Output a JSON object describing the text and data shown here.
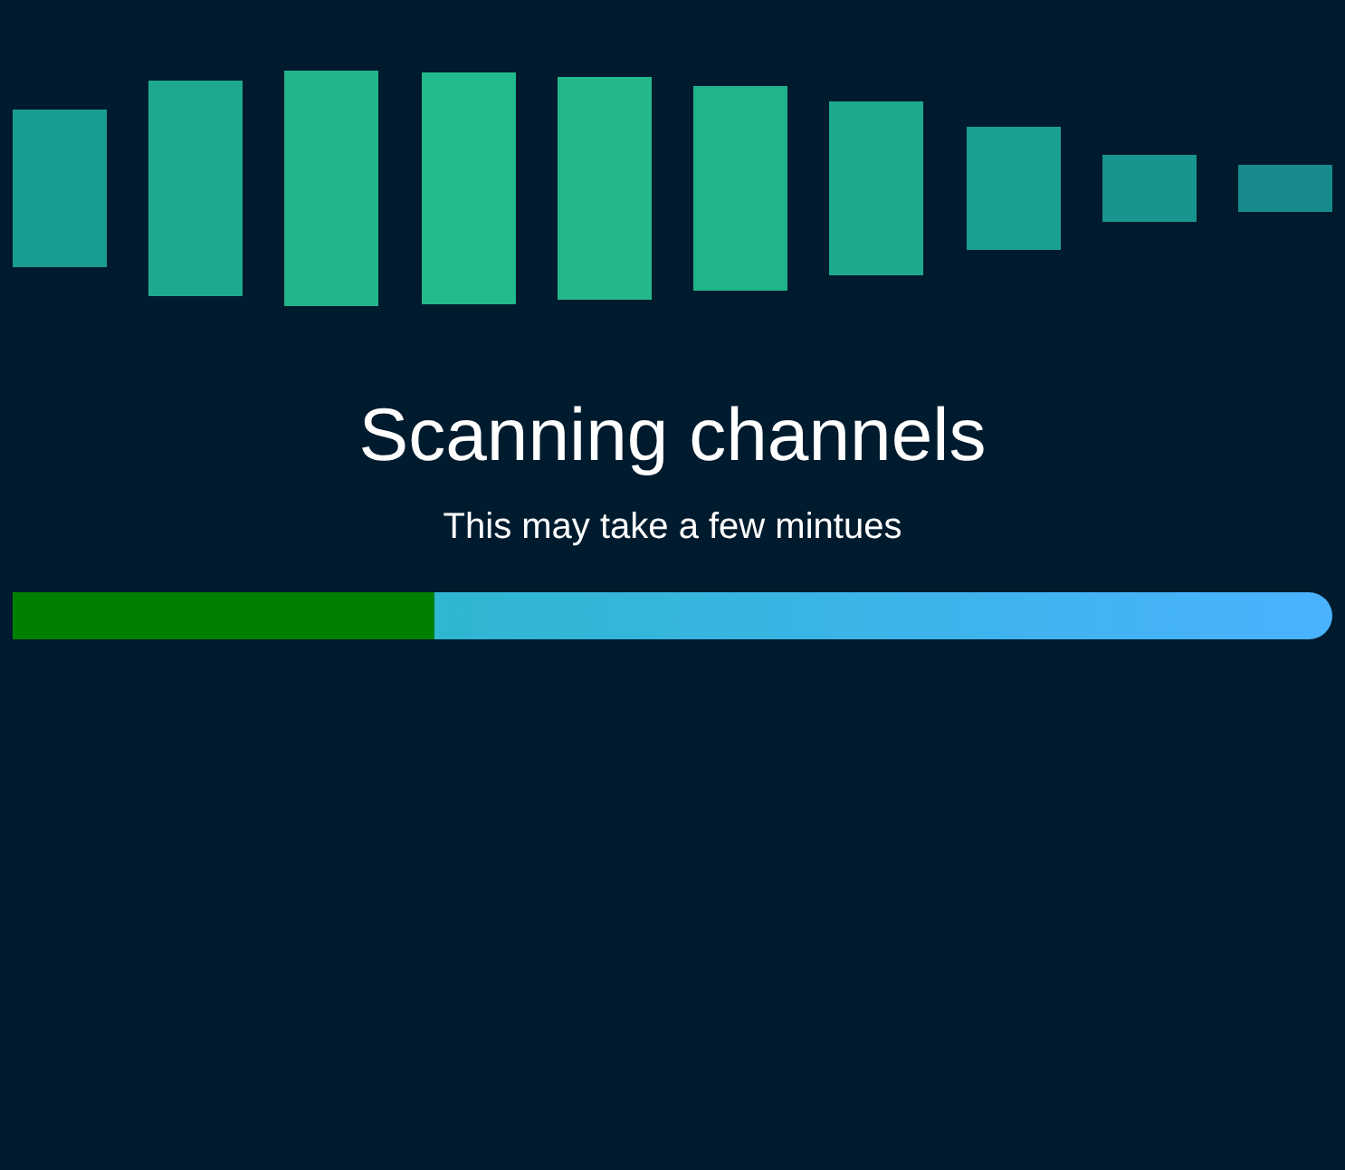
{
  "title": "Scanning channels",
  "subtitle": "This may take a few mintues",
  "progress": {
    "level": 0.32
  }
}
